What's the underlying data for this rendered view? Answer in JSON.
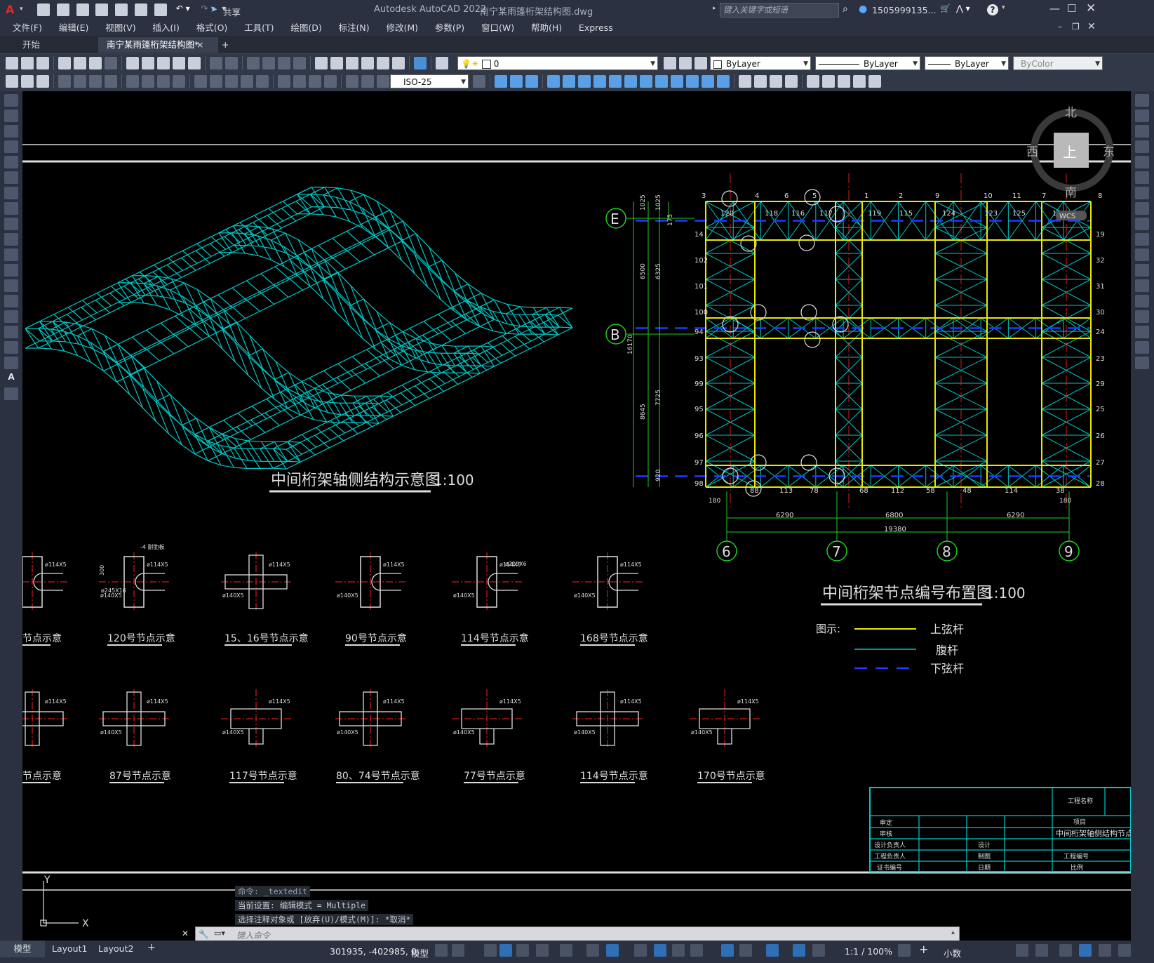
{
  "colors": {
    "accent": "#2f6fb5",
    "canvas": "#000000",
    "cyan": "#00c8c8",
    "yellow": "#e8e800",
    "blue": "#1a3cff",
    "green": "#22cc22",
    "red": "#ff2020"
  },
  "titlebar": {
    "app_logo": "A",
    "share_label": "共享",
    "title": "Autodesk AutoCAD 2022",
    "filename": "南宁某雨篷桁架结构图.dwg",
    "search_placeholder": "键入关键字或短语",
    "user": "1505999135...",
    "help": "?"
  },
  "menu": [
    "文件(F)",
    "编辑(E)",
    "视图(V)",
    "插入(I)",
    "格式(O)",
    "工具(T)",
    "绘图(D)",
    "标注(N)",
    "修改(M)",
    "参数(P)",
    "窗口(W)",
    "帮助(H)",
    "Express"
  ],
  "tabs": {
    "start": "开始",
    "doc": "南宁某雨篷桁架结构图*",
    "close": "×",
    "add": "+"
  },
  "toolbar": {
    "layer_value": "0",
    "color": "ByLayer",
    "linetype": "ByLayer",
    "lineweight": "ByLayer",
    "plotstyle": "ByColor",
    "dimstyle": "ISO-25"
  },
  "viewcube": {
    "north": "北",
    "south": "南",
    "east": "东",
    "west": "西",
    "top": "上",
    "wcs": "WCS"
  },
  "drawing": {
    "iso_title": "中间桁架轴侧结构示意图",
    "iso_scale": "1:100",
    "plan_title": "中间桁架节点编号布置图",
    "plan_scale": "1:100",
    "legend_label": "图示:",
    "legend_top": "上弦杆",
    "legend_web": "腹杆",
    "legend_bottom": "下弦杆",
    "axes_bottom": [
      "6",
      "7",
      "8",
      "9"
    ],
    "axes_left": [
      "E",
      "B"
    ],
    "dims_bottom": [
      "6290",
      "6800",
      "6290"
    ],
    "dims_total": "19380",
    "dims_edge": [
      "180",
      "180"
    ],
    "dims_left": [
      "1025",
      "1025",
      "175",
      "6500",
      "6325",
      "16170",
      "8645",
      "7725",
      "920"
    ],
    "top_nums": [
      "3",
      "4",
      "6",
      "5",
      "1",
      "2",
      "9",
      "10",
      "11",
      "7",
      "8"
    ],
    "left_nums": [
      "14",
      "102",
      "101",
      "100",
      "94",
      "93",
      "99",
      "95",
      "96",
      "97",
      "98"
    ],
    "right_nums": [
      "19",
      "32",
      "31",
      "30",
      "24",
      "23",
      "29",
      "25",
      "26",
      "27",
      "28"
    ],
    "bottom_nums": [
      "88",
      "113",
      "78",
      "68",
      "112",
      "58",
      "48",
      "114",
      "38"
    ],
    "row1_nodes": [
      "120",
      "118",
      "116",
      "117",
      "119",
      "115",
      "124",
      "123",
      "125",
      "126"
    ],
    "details_row1": [
      "节点示意",
      "120号节点示意",
      "15、16号节点示意",
      "90号节点示意",
      "114号节点示意",
      "168号节点示意"
    ],
    "details_row2": [
      "节点示意",
      "87号节点示意",
      "117号节点示意",
      "80、74号节点示意",
      "77号节点示意",
      "114号节点示意",
      "170号节点示意"
    ],
    "detail_specs": [
      "ø114X5",
      "ø140X5",
      "ø245X16",
      "ø219X6",
      "-4 耐肋板",
      "300"
    ],
    "titleblock": {
      "project_name": "工程名称",
      "item": "项目",
      "drawing_title": "中间桁架轴侧结构节点编号布置图及相",
      "rows": [
        "审定",
        "审核",
        "设计负责人",
        "工程负责人",
        "证书编号"
      ],
      "mid": [
        "设计",
        "制图",
        "日期"
      ],
      "right": [
        "工程编号",
        "比例"
      ]
    }
  },
  "command": {
    "history": [
      "命令: _textedit",
      "当前设置: 编辑模式 = Multiple",
      "选择注释对象或 [放弃(U)/模式(M)]: *取消*"
    ],
    "placeholder": "键入命令"
  },
  "status": {
    "layout_tabs": [
      "模型",
      "Layout1",
      "Layout2"
    ],
    "coords": "301935, -402985, 0",
    "model": "模型",
    "scale": "1:1 / 100%",
    "units": "小数"
  },
  "ucs": {
    "x": "X",
    "y": "Y"
  }
}
